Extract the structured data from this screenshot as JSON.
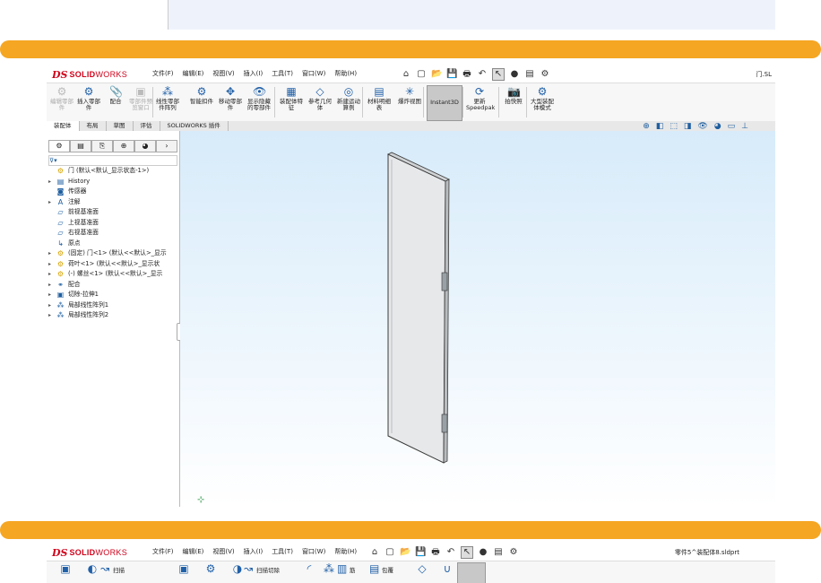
{
  "app": {
    "logo_ds": "DS",
    "logo_brand": "SOLID",
    "logo_brand2": "WORKS"
  },
  "menus": [
    "文件(F)",
    "编辑(E)",
    "视图(V)",
    "插入(I)",
    "工具(T)",
    "窗口(W)",
    "帮助(H)"
  ],
  "shot1": {
    "doc_title": "门.SL",
    "ribbon": [
      {
        "label": "编辑零部件",
        "icon": "edit-component-icon",
        "glyph": "⚙",
        "dim": true
      },
      {
        "label": "插入零部件",
        "icon": "insert-component-icon",
        "glyph": "⚙",
        "dim": false
      },
      {
        "label": "配合",
        "icon": "mate-icon",
        "glyph": "📎",
        "dim": false
      },
      {
        "label": "零部件预览窗口",
        "icon": "component-preview-icon",
        "glyph": "▣",
        "dim": true
      },
      {
        "label": "线性零部件阵列",
        "icon": "linear-pattern-icon",
        "glyph": "⁂",
        "dim": false
      },
      {
        "label": "智能扣件",
        "icon": "smart-fastener-icon",
        "glyph": "⚙",
        "dim": false
      },
      {
        "label": "移动零部件",
        "icon": "move-component-icon",
        "glyph": "✥",
        "dim": false
      },
      {
        "label": "显示隐藏的零部件",
        "icon": "show-hidden-icon",
        "glyph": "👁",
        "dim": false
      },
      {
        "label": "装配体特征",
        "icon": "assembly-feature-icon",
        "glyph": "▦",
        "dim": false
      },
      {
        "label": "参考几何体",
        "icon": "reference-geometry-icon",
        "glyph": "◇",
        "dim": false
      },
      {
        "label": "新建运动算例",
        "icon": "motion-study-icon",
        "glyph": "◎",
        "dim": false
      },
      {
        "label": "材料明细表",
        "icon": "bom-icon",
        "glyph": "▤",
        "dim": false
      },
      {
        "label": "爆炸视图",
        "icon": "exploded-view-icon",
        "glyph": "✳",
        "dim": false
      },
      {
        "label": "Instant3D",
        "icon": "instant3d-icon",
        "glyph": "",
        "dim": false,
        "active": true
      },
      {
        "label": "更新Speedpak",
        "icon": "speedpak-icon",
        "glyph": "⟳",
        "dim": false
      },
      {
        "label": "拍快照",
        "icon": "snapshot-icon",
        "glyph": "📷",
        "dim": false
      },
      {
        "label": "大型装配体模式",
        "icon": "large-assembly-icon",
        "glyph": "⚙",
        "dim": false
      }
    ],
    "tabs": [
      "装配体",
      "布局",
      "草图",
      "评估",
      "SOLIDWORKS 插件"
    ],
    "tree": [
      {
        "label": "门 (默认<默认_显示状态-1>)",
        "icon": "assembly-icon",
        "glyph": "⚙",
        "exp": "",
        "indent": 0
      },
      {
        "label": "History",
        "icon": "history-icon",
        "glyph": "▤",
        "exp": "▸",
        "indent": 1
      },
      {
        "label": "传感器",
        "icon": "sensor-icon",
        "glyph": "◙",
        "exp": "",
        "indent": 1
      },
      {
        "label": "注解",
        "icon": "annotation-icon",
        "glyph": "A",
        "exp": "▸",
        "indent": 1
      },
      {
        "label": "前视基准面",
        "icon": "plane-icon",
        "glyph": "▱",
        "exp": "",
        "indent": 1
      },
      {
        "label": "上视基准面",
        "icon": "plane-icon",
        "glyph": "▱",
        "exp": "",
        "indent": 1
      },
      {
        "label": "右视基准面",
        "icon": "plane-icon",
        "glyph": "▱",
        "exp": "",
        "indent": 1
      },
      {
        "label": "原点",
        "icon": "origin-icon",
        "glyph": "↳",
        "exp": "",
        "indent": 1
      },
      {
        "label": "(固定) 门<1> (默认<<默认>_显示",
        "icon": "part-icon",
        "glyph": "⚙",
        "exp": "▸",
        "indent": 1
      },
      {
        "label": "荷叶<1> (默认<<默认>_显示状",
        "icon": "part-icon",
        "glyph": "⚙",
        "exp": "▸",
        "indent": 1
      },
      {
        "label": "(-) 螺丝<1> (默认<<默认>_显示",
        "icon": "part-icon",
        "glyph": "⚙",
        "exp": "▸",
        "indent": 1
      },
      {
        "label": "配合",
        "icon": "mates-icon",
        "glyph": "⚭",
        "exp": "▸",
        "indent": 1
      },
      {
        "label": "切除-拉伸1",
        "icon": "cut-extrude-icon",
        "glyph": "▣",
        "exp": "▸",
        "indent": 1
      },
      {
        "label": "局部线性阵列1",
        "icon": "pattern-icon",
        "glyph": "⁂",
        "exp": "▸",
        "indent": 1
      },
      {
        "label": "局部线性阵列2",
        "icon": "pattern-icon",
        "glyph": "⁂",
        "exp": "▸",
        "indent": 1
      }
    ]
  },
  "shot2": {
    "doc_title": "零件5^装配体8.sldprt",
    "ribbon": [
      {
        "label": "",
        "icon": "extrude-boss-icon",
        "glyph": "▣"
      },
      {
        "label": "",
        "icon": "revolve-boss-icon",
        "glyph": "◐"
      },
      {
        "label": "扫描",
        "icon": "sweep-icon",
        "glyph": "↝"
      },
      {
        "label": "",
        "icon": "extrude-cut-icon",
        "glyph": "▣"
      },
      {
        "label": "",
        "icon": "hole-wizard-icon",
        "glyph": "⚙"
      },
      {
        "label": "",
        "icon": "revolve-cut-icon",
        "glyph": "◑"
      },
      {
        "label": "扫描切除",
        "icon": "swept-cut-icon",
        "glyph": "↝"
      },
      {
        "label": "",
        "icon": "fillet-icon",
        "glyph": "◜"
      },
      {
        "label": "",
        "icon": "linear-pattern-icon",
        "glyph": "⁂"
      },
      {
        "label": "筋",
        "icon": "rib-icon",
        "glyph": "▥"
      },
      {
        "label": "包覆",
        "icon": "wrap-icon",
        "glyph": "▤"
      },
      {
        "label": "",
        "icon": "reference-icon",
        "glyph": "◇"
      },
      {
        "label": "",
        "icon": "curves-icon",
        "glyph": "∪"
      },
      {
        "label": "",
        "icon": "instant3d-icon",
        "glyph": "",
        "active": true
      }
    ]
  }
}
